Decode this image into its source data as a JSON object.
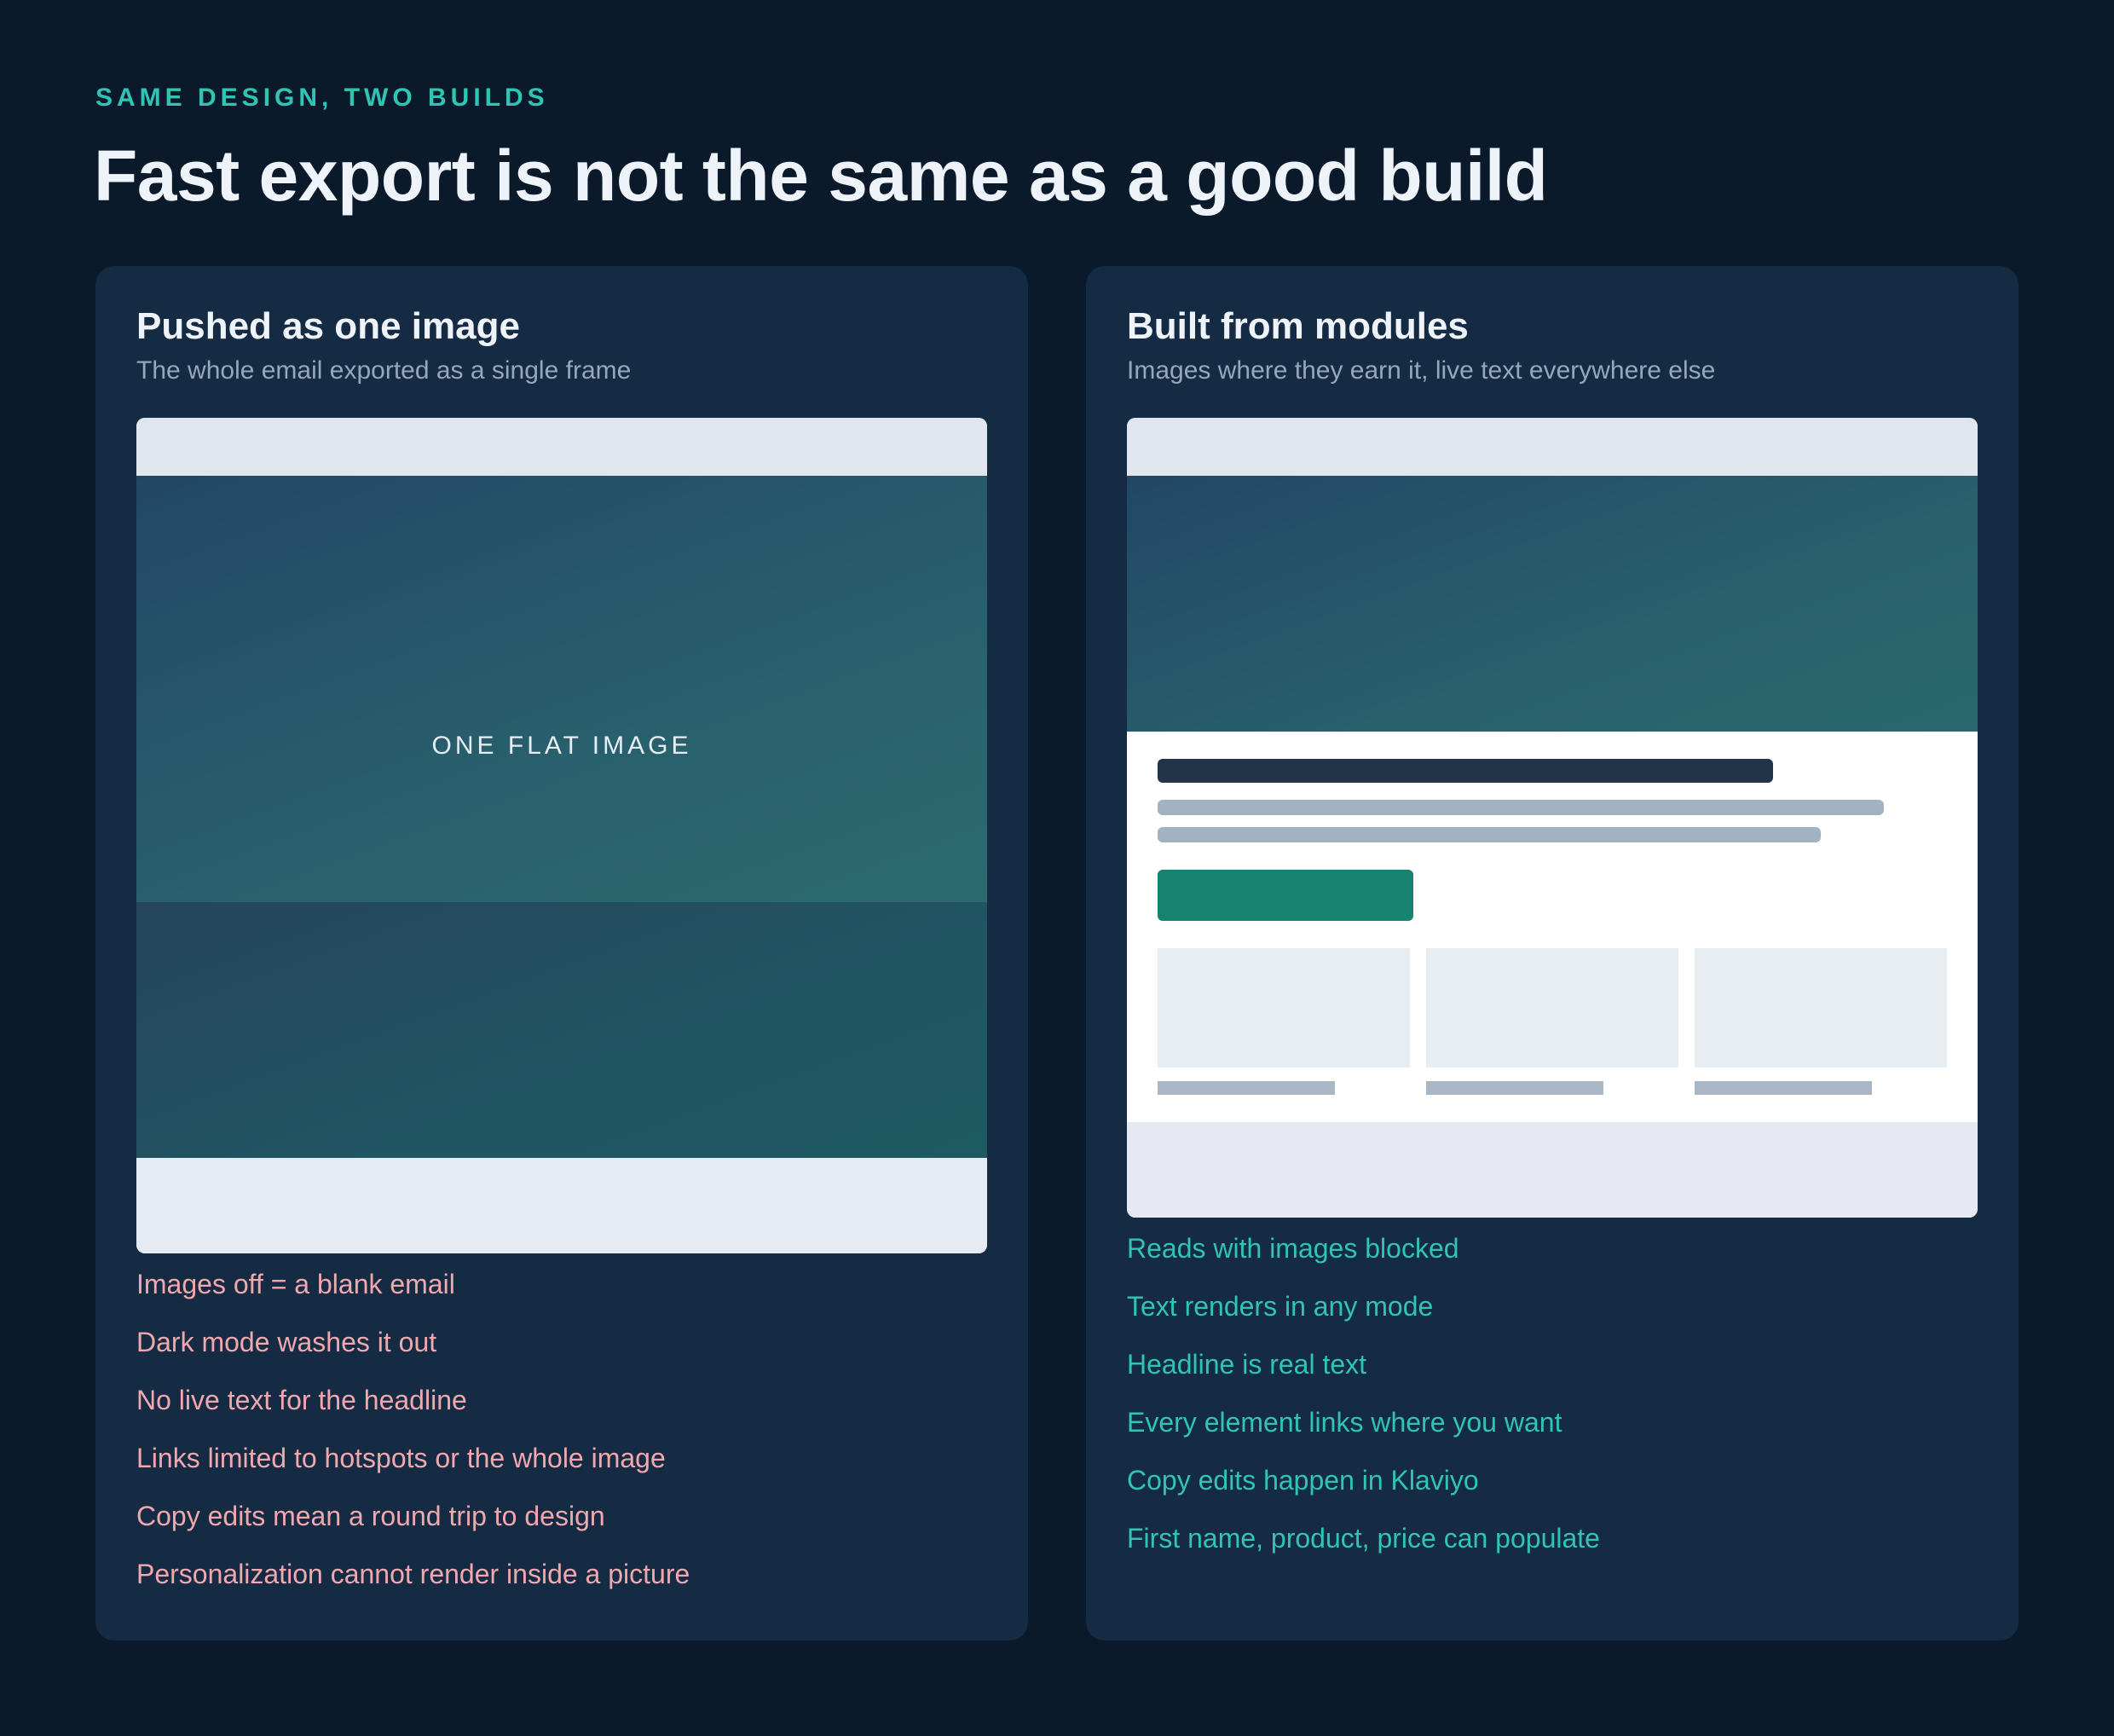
{
  "header": {
    "eyebrow": "SAME DESIGN, TWO BUILDS",
    "title": "Fast export is not the same as a good build"
  },
  "left_card": {
    "title": "Pushed as one image",
    "subtitle": "The whole email exported as a single frame",
    "mock_label": "ONE FLAT IMAGE",
    "points": [
      "Images off = a blank email",
      "Dark mode washes it out",
      "No live text for the headline",
      "Links limited to hotspots or the whole image",
      "Copy edits mean a round trip to design",
      "Personalization cannot render inside a picture"
    ]
  },
  "right_card": {
    "title": "Built from modules",
    "subtitle": "Images where they earn it, live text everywhere else",
    "points": [
      "Reads with images blocked",
      "Text renders in any mode",
      "Headline is real text",
      "Every element links where you want",
      "Copy edits happen in Klaviyo",
      "First name, product, price can populate"
    ]
  },
  "colors": {
    "background": "#0b1a2b",
    "card": "#152a43",
    "accent_teal": "#2fc4b4",
    "negative_pink": "#f0a7ad",
    "cta_green": "#15836f"
  }
}
